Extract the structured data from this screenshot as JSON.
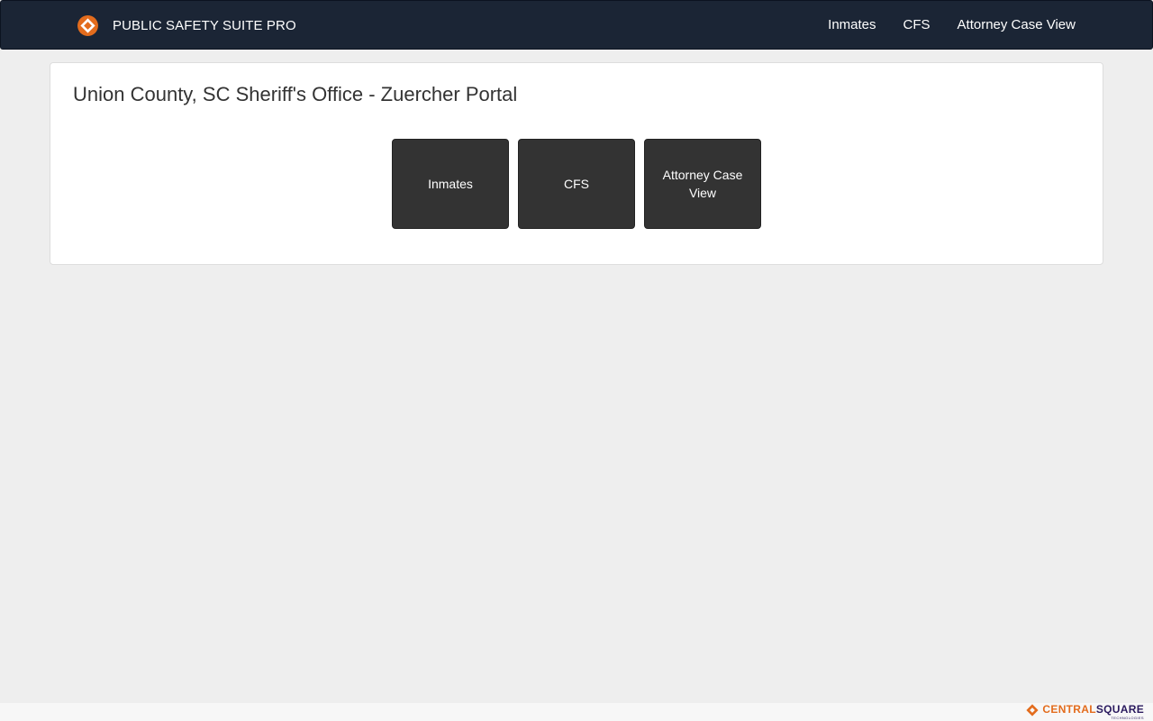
{
  "navbar": {
    "brand_text": "PUBLIC SAFETY SUITE PRO",
    "links": [
      {
        "label": "Inmates"
      },
      {
        "label": "CFS"
      },
      {
        "label": "Attorney Case View"
      }
    ],
    "logo_icon": "centralsquare-logo-icon"
  },
  "panel": {
    "title": "Union County, SC Sheriff's Office - Zuercher Portal",
    "tiles": [
      {
        "label": "Inmates"
      },
      {
        "label": "CFS"
      },
      {
        "label": "Attorney Case View"
      }
    ]
  },
  "footer": {
    "logo_word_1": "CENTRAL",
    "logo_word_2": "SQUARE",
    "logo_sub": "TECHNOLOGIES"
  },
  "colors": {
    "navbar_bg": "#1b2535",
    "page_bg": "#eeeeee",
    "tile_bg": "#333333",
    "accent_orange": "#e36c1d",
    "brand_purple": "#2a1a5e"
  }
}
